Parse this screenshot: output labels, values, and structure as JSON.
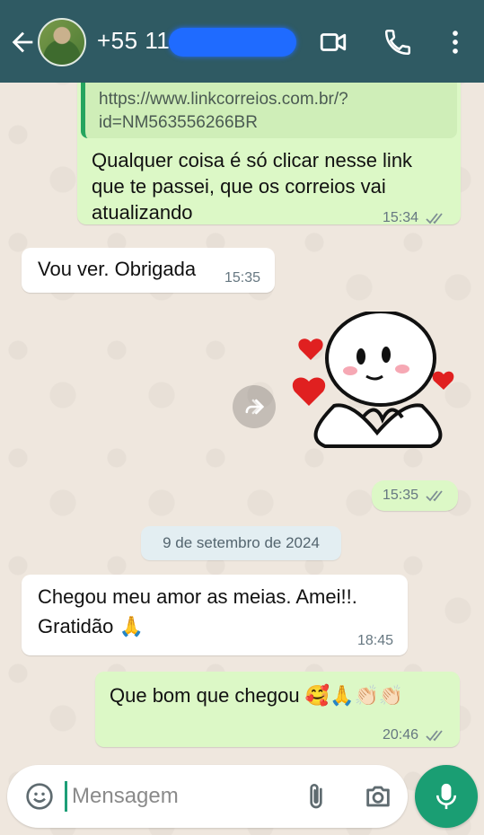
{
  "header": {
    "contact_name": "+55 11 9",
    "accent_color": "#2f5a63"
  },
  "messages": [
    {
      "direction": "outgoing",
      "quoted_link": "https://www.linkcorreios.com.br/?\nid=NM563556266BR",
      "text_lines": [
        "Qualquer coisa é só clicar nesse link",
        "que te passei, que os correios vai",
        "atualizando"
      ],
      "time": "15:34"
    },
    {
      "direction": "incoming",
      "text": "Vou ver. Obrigada",
      "time": "15:35"
    },
    {
      "direction": "outgoing",
      "type": "sticker",
      "time": "15:35"
    },
    {
      "direction": "incoming",
      "text_lines": [
        "Chegou meu amor as meias. Amei!!.",
        "Gratidão 🙏"
      ],
      "time": "18:45"
    },
    {
      "direction": "outgoing",
      "text": "Que bom que chegou 🥰🙏👏🏻👏🏻",
      "time": "20:46"
    }
  ],
  "date_separator": "9 de setembro de 2024",
  "composer": {
    "placeholder": "Mensagem"
  },
  "colors": {
    "outgoing_bubble": "#dcf8c6",
    "incoming_bubble": "#ffffff",
    "send_button": "#1a9e73"
  }
}
